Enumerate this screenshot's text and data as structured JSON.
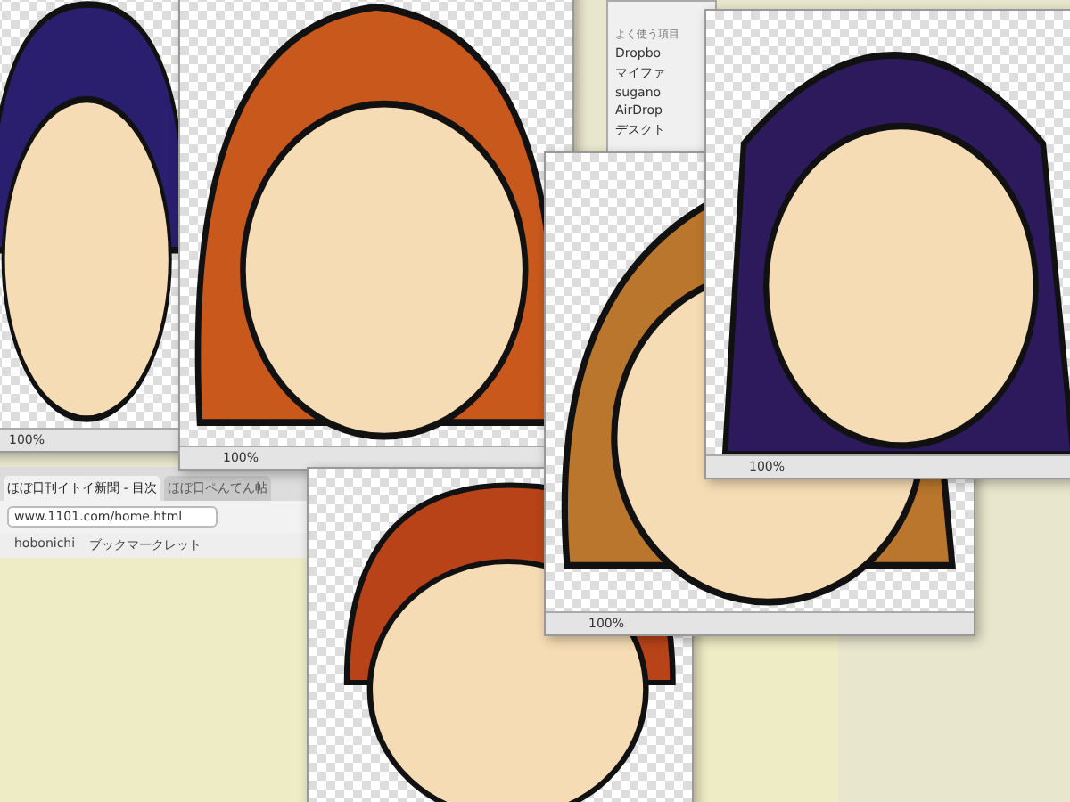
{
  "browser": {
    "tabs": [
      {
        "label": "ほぼ日刊イトイ新聞 - 目次",
        "selected": true
      },
      {
        "label": "ほぼ日ペんてん帖",
        "selected": false
      }
    ],
    "address": "www.1101.com/home.html",
    "bookmarks": [
      "hobonichi",
      "ブックマークレット"
    ]
  },
  "finder": {
    "sidebar_title": "よく使う項目",
    "items": [
      "Dropbo",
      "マイファ",
      "sugano",
      "AirDrop",
      "デスクト"
    ]
  },
  "windows": [
    {
      "zoom": "100%",
      "color": "#2a1f6e",
      "kind": "short"
    },
    {
      "zoom": "100%",
      "color": "#c8581c",
      "kind": "bob"
    },
    {
      "color": "#b84318",
      "kind": "short"
    },
    {
      "zoom": "100%",
      "color": "#b9762c",
      "kind": "bangs"
    },
    {
      "zoom": "100%",
      "color": "#2c1a5c",
      "kind": "long"
    }
  ]
}
